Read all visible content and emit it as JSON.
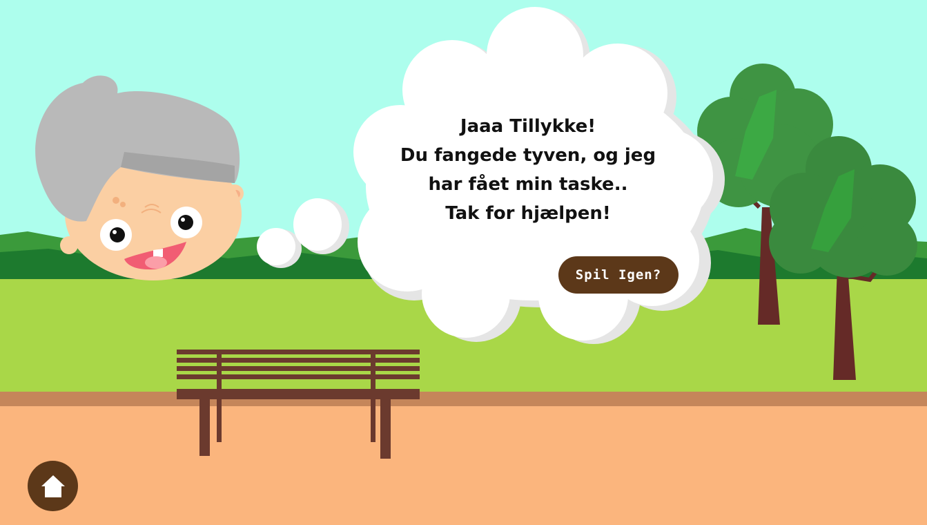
{
  "scene": {
    "name": "park",
    "message_lines": [
      "Jaaa Tillykke!",
      "Du fangede tyven, og jeg",
      "har fået min taske..",
      "Tak for hjælpen!"
    ],
    "play_again_label": "Spil Igen?",
    "home_icon": "home-icon"
  },
  "colors": {
    "sky": "#adfeed",
    "hills": "#1d7a2e",
    "grass": "#a9d748",
    "path_edge": "#c5865a",
    "ground": "#fbb57d",
    "wood": "#5c3819",
    "bench": "#6b3a2e",
    "tree": "#3f9443",
    "trunk": "#652a27"
  }
}
